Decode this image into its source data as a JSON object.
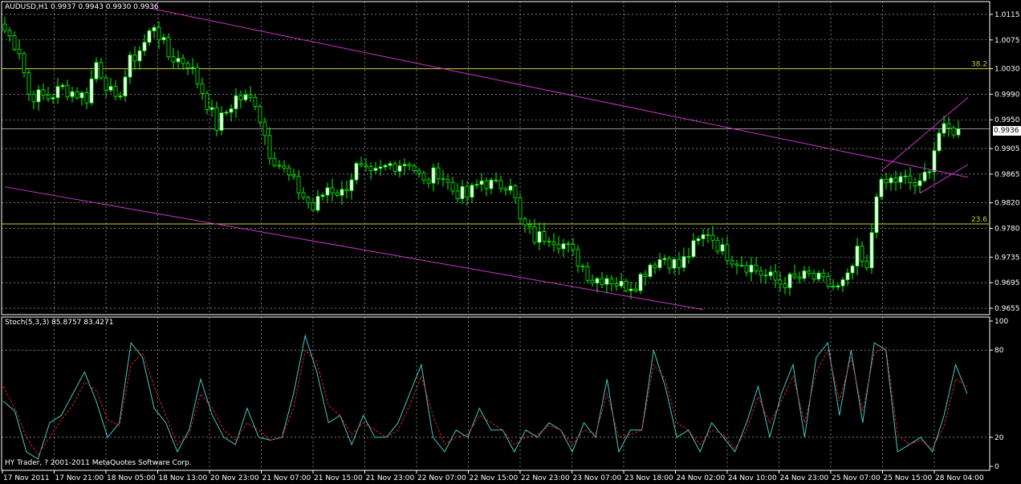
{
  "chart_data": [
    {
      "type": "candlestick",
      "symbol_header": "AUDUSD,H1  0.9937 0.9943 0.9930 0.9936",
      "current_price_label": "0.9936",
      "ylim": [
        0.9645,
        1.0135
      ],
      "y_ticks": [
        "1.0115",
        "1.0075",
        "1.0030",
        "0.9990",
        "0.9950",
        "0.9905",
        "0.9865",
        "0.9820",
        "0.9780",
        "0.9735",
        "0.9695",
        "0.9655"
      ],
      "x_tick_labels": [
        "17 Nov 2011",
        "17 Nov 21:00",
        "18 Nov 05:00",
        "18 Nov 13:00",
        "20 Nov 23:00",
        "21 Nov 07:00",
        "21 Nov 15:00",
        "21 Nov 23:00",
        "22 Nov 07:00",
        "22 Nov 15:00",
        "22 Nov 23:00",
        "23 Nov 07:00",
        "23 Nov 18:00",
        "24 Nov 02:00",
        "24 Nov 10:00",
        "24 Nov 23:00",
        "25 Nov 07:00",
        "25 Nov 15:00",
        "28 Nov 04:00"
      ],
      "fibonacci_levels": [
        {
          "label": "38.2",
          "price": 1.003
        },
        {
          "label": "23.6",
          "price": 0.9787
        }
      ],
      "trend_lines": [
        {
          "from_bar": 30,
          "from_price": 1.0125,
          "to_bar": 200,
          "to_price": 0.986
        },
        {
          "from_bar": 0,
          "from_price": 0.9845,
          "to_bar": 145,
          "to_price": 0.9653
        },
        {
          "from_bar": 182,
          "from_price": 0.987,
          "to_bar": 200,
          "to_price": 0.9985
        },
        {
          "from_bar": 190,
          "from_price": 0.9835,
          "to_bar": 200,
          "to_price": 0.988
        }
      ],
      "colors": {
        "bull_candle": "#ffffff",
        "bear_candle": "#000000",
        "wick": "#00ff00",
        "fib": "#cccc33",
        "trend": "#cc33cc",
        "grid": "#c8c8c8"
      },
      "anchors": [
        [
          0,
          1.009
        ],
        [
          3,
          1.006
        ],
        [
          5,
          0.999
        ],
        [
          9,
          0.9985
        ],
        [
          12,
          1.0
        ],
        [
          17,
          0.9985
        ],
        [
          19,
          1.004
        ],
        [
          23,
          0.9975
        ],
        [
          26,
          1.004
        ],
        [
          29,
          1.007
        ],
        [
          31,
          1.01
        ],
        [
          34,
          1.005
        ],
        [
          38,
          1.004
        ],
        [
          41,
          0.9995
        ],
        [
          44,
          0.994
        ],
        [
          48,
          0.9985
        ],
        [
          52,
          0.998
        ],
        [
          55,
          0.99
        ],
        [
          58,
          0.987
        ],
        [
          61,
          0.984
        ],
        [
          64,
          0.981
        ],
        [
          67,
          0.9845
        ],
        [
          70,
          0.9835
        ],
        [
          73,
          0.9875
        ],
        [
          76,
          0.986
        ],
        [
          80,
          0.988
        ],
        [
          84,
          0.9885
        ],
        [
          87,
          0.985
        ],
        [
          90,
          0.987
        ],
        [
          93,
          0.984
        ],
        [
          96,
          0.983
        ],
        [
          99,
          0.9855
        ],
        [
          102,
          0.9845
        ],
        [
          105,
          0.9855
        ],
        [
          107,
          0.979
        ],
        [
          110,
          0.9765
        ],
        [
          113,
          0.977
        ],
        [
          116,
          0.9755
        ],
        [
          119,
          0.973
        ],
        [
          122,
          0.97
        ],
        [
          125,
          0.9705
        ],
        [
          128,
          0.969
        ],
        [
          131,
          0.9695
        ],
        [
          134,
          0.9725
        ],
        [
          137,
          0.9735
        ],
        [
          140,
          0.972
        ],
        [
          143,
          0.975
        ],
        [
          146,
          0.9775
        ],
        [
          149,
          0.9745
        ],
        [
          152,
          0.973
        ],
        [
          155,
          0.972
        ],
        [
          158,
          0.9705
        ],
        [
          161,
          0.9695
        ],
        [
          164,
          0.97
        ],
        [
          167,
          0.9705
        ],
        [
          170,
          0.9695
        ],
        [
          173,
          0.9685
        ],
        [
          175,
          0.97
        ],
        [
          177,
          0.974
        ],
        [
          179,
          0.971
        ],
        [
          181,
          0.984
        ],
        [
          184,
          0.9855
        ],
        [
          187,
          0.9855
        ],
        [
          190,
          0.9845
        ],
        [
          192,
          0.988
        ],
        [
          194,
          0.993
        ],
        [
          197,
          0.9935
        ],
        [
          198,
          0.9936
        ]
      ]
    },
    {
      "type": "line",
      "indicator_header": "Stoch(5,3,3) 85.8757 83.4271",
      "ylim": [
        0,
        100
      ],
      "y_ticks": [
        "100",
        "80",
        "20",
        "0"
      ],
      "levels": [
        80,
        20
      ],
      "series": [
        {
          "color": "#45c8c8",
          "style": "solid",
          "values": [
            45,
            38,
            10,
            5,
            30,
            35,
            50,
            65,
            45,
            20,
            30,
            85,
            75,
            40,
            30,
            10,
            25,
            60,
            35,
            20,
            15,
            40,
            20,
            18,
            20,
            50,
            90,
            65,
            30,
            35,
            15,
            35,
            20,
            20,
            30,
            50,
            70,
            20,
            10,
            25,
            20,
            40,
            25,
            25,
            10,
            25,
            20,
            30,
            25,
            10,
            30,
            20,
            60,
            10,
            25,
            25,
            80,
            55,
            20,
            25,
            10,
            30,
            20,
            10,
            30,
            55,
            20,
            50,
            70,
            20,
            75,
            85,
            35,
            80,
            30,
            85,
            80,
            10,
            15,
            20,
            10,
            35,
            70,
            50
          ]
        },
        {
          "color": "#dd2222",
          "style": "dashed",
          "values": [
            55,
            40,
            20,
            8,
            20,
            32,
            42,
            58,
            52,
            32,
            28,
            70,
            78,
            55,
            35,
            15,
            22,
            50,
            40,
            25,
            18,
            30,
            25,
            18,
            20,
            40,
            80,
            72,
            42,
            35,
            22,
            30,
            25,
            20,
            25,
            42,
            62,
            35,
            15,
            20,
            22,
            35,
            30,
            25,
            15,
            20,
            22,
            28,
            25,
            15,
            25,
            22,
            50,
            20,
            22,
            25,
            70,
            60,
            30,
            25,
            15,
            25,
            22,
            12,
            25,
            48,
            30,
            45,
            62,
            30,
            65,
            80,
            45,
            75,
            38,
            78,
            82,
            22,
            15,
            18,
            12,
            28,
            60,
            55
          ]
        }
      ]
    }
  ],
  "footer_text": "HY Trader, ? 2001-2011 MetaQuotes Software Corp."
}
